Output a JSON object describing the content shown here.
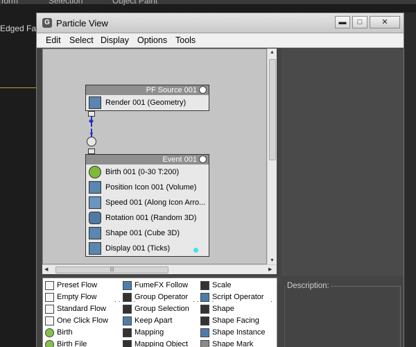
{
  "background": {
    "tabs": [
      "form",
      "Selection",
      "Object Paint"
    ],
    "viewport_label": "Edged Faces"
  },
  "window": {
    "title": "Particle View",
    "buttons": {
      "minimize": "▬",
      "maximize": "□",
      "close": "✕"
    }
  },
  "menu": [
    "Edit",
    "Select",
    "Display",
    "Options",
    "Tools"
  ],
  "graph": {
    "source_node": {
      "header": "PF Source 001",
      "rows": [
        {
          "label": "Render 001 (Geometry)",
          "icon": "render-teapot-icon"
        }
      ]
    },
    "event_node": {
      "header": "Event 001",
      "rows": [
        {
          "label": "Birth 001 (0-30 T:200)",
          "icon": "birth-icon"
        },
        {
          "label": "Position Icon 001 (Volume)",
          "icon": "position-icon"
        },
        {
          "label": "Speed 001 (Along Icon Arro...",
          "icon": "speed-icon"
        },
        {
          "label": "Rotation 001 (Random 3D)",
          "icon": "rotation-icon"
        },
        {
          "label": "Shape 001 (Cube 3D)",
          "icon": "shape-icon"
        },
        {
          "label": "Display 001 (Ticks)",
          "icon": "display-icon"
        }
      ]
    },
    "hscroll_thumb": "|||"
  },
  "description": {
    "label": "Description:"
  },
  "depot": {
    "columns": [
      [
        "Preset Flow",
        "Empty Flow",
        "Standard Flow",
        "One Click Flow",
        "Birth",
        "Birth File"
      ],
      [
        "FumeFX Follow",
        "Group Operator",
        "Group Selection",
        "Keep Apart",
        "Mapping",
        "Mapping Object"
      ],
      [
        "Scale",
        "Script Operator",
        "Shape",
        "Shape Facing",
        "Shape Instance",
        "Shape Mark"
      ]
    ]
  },
  "colors": {
    "wire": "#2230c8",
    "node_header": "#8f8f8f",
    "graph_bg": "#c4c4c4",
    "accent_line": "#c4a238"
  }
}
